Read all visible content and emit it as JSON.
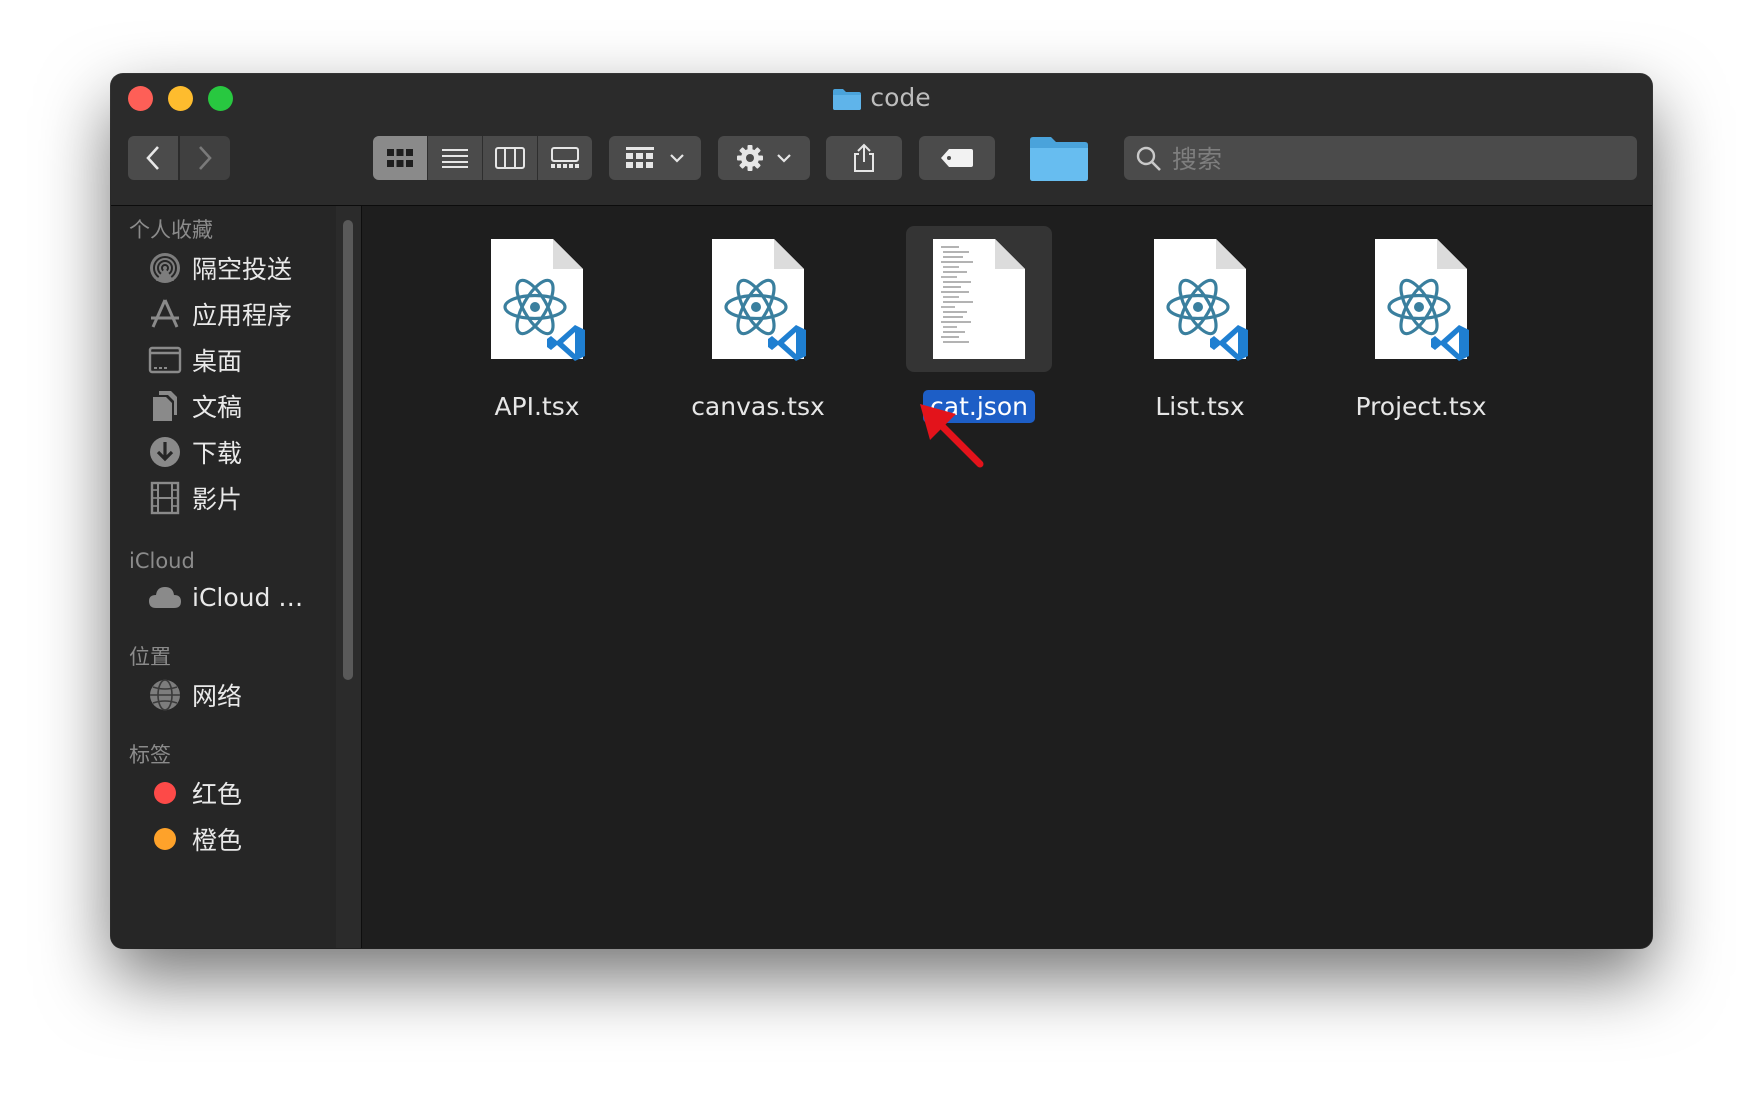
{
  "window": {
    "title": "code",
    "title_icon": "folder-icon"
  },
  "toolbar": {
    "back_icon": "chevron-left-icon",
    "forward_icon": "chevron-right-icon",
    "view_modes": [
      "icon-view-icon",
      "list-view-icon",
      "column-view-icon",
      "gallery-view-icon"
    ],
    "active_view": "icon-view-icon",
    "group_icon": "group-icon",
    "action_icon": "gear-icon",
    "share_icon": "share-icon",
    "tag_icon": "tag-icon",
    "search_placeholder": "搜索"
  },
  "sidebar": {
    "favorites_title": "个人收藏",
    "favorites": [
      {
        "label": "隔空投送",
        "icon": "airdrop-icon"
      },
      {
        "label": "应用程序",
        "icon": "applications-icon"
      },
      {
        "label": "桌面",
        "icon": "desktop-icon"
      },
      {
        "label": "文稿",
        "icon": "documents-icon"
      },
      {
        "label": "下载",
        "icon": "downloads-icon"
      },
      {
        "label": "影片",
        "icon": "movies-icon"
      }
    ],
    "icloud_title": "iCloud",
    "icloud_item": {
      "label": "iCloud …",
      "icon": "cloud-icon"
    },
    "locations_title": "位置",
    "locations_item": {
      "label": "网络",
      "icon": "network-icon"
    },
    "tags_title": "标签",
    "tags": [
      {
        "label": "红色",
        "color": "#fd4a48"
      },
      {
        "label": "橙色",
        "color": "#fea22a"
      }
    ]
  },
  "files": [
    {
      "name": "API.tsx",
      "type": "tsx",
      "selected": false
    },
    {
      "name": "canvas.tsx",
      "type": "tsx",
      "selected": false
    },
    {
      "name": "cat.json",
      "type": "json",
      "selected": true
    },
    {
      "name": "List.tsx",
      "type": "tsx",
      "selected": false
    },
    {
      "name": "Project.tsx",
      "type": "tsx",
      "selected": false
    }
  ],
  "colors": {
    "selection": "#1d5ec6",
    "folder": "#5fb4ea",
    "annotation_arrow": "#e3131b",
    "react": "#3a7f9e",
    "vscode": "#1f7fd1"
  }
}
